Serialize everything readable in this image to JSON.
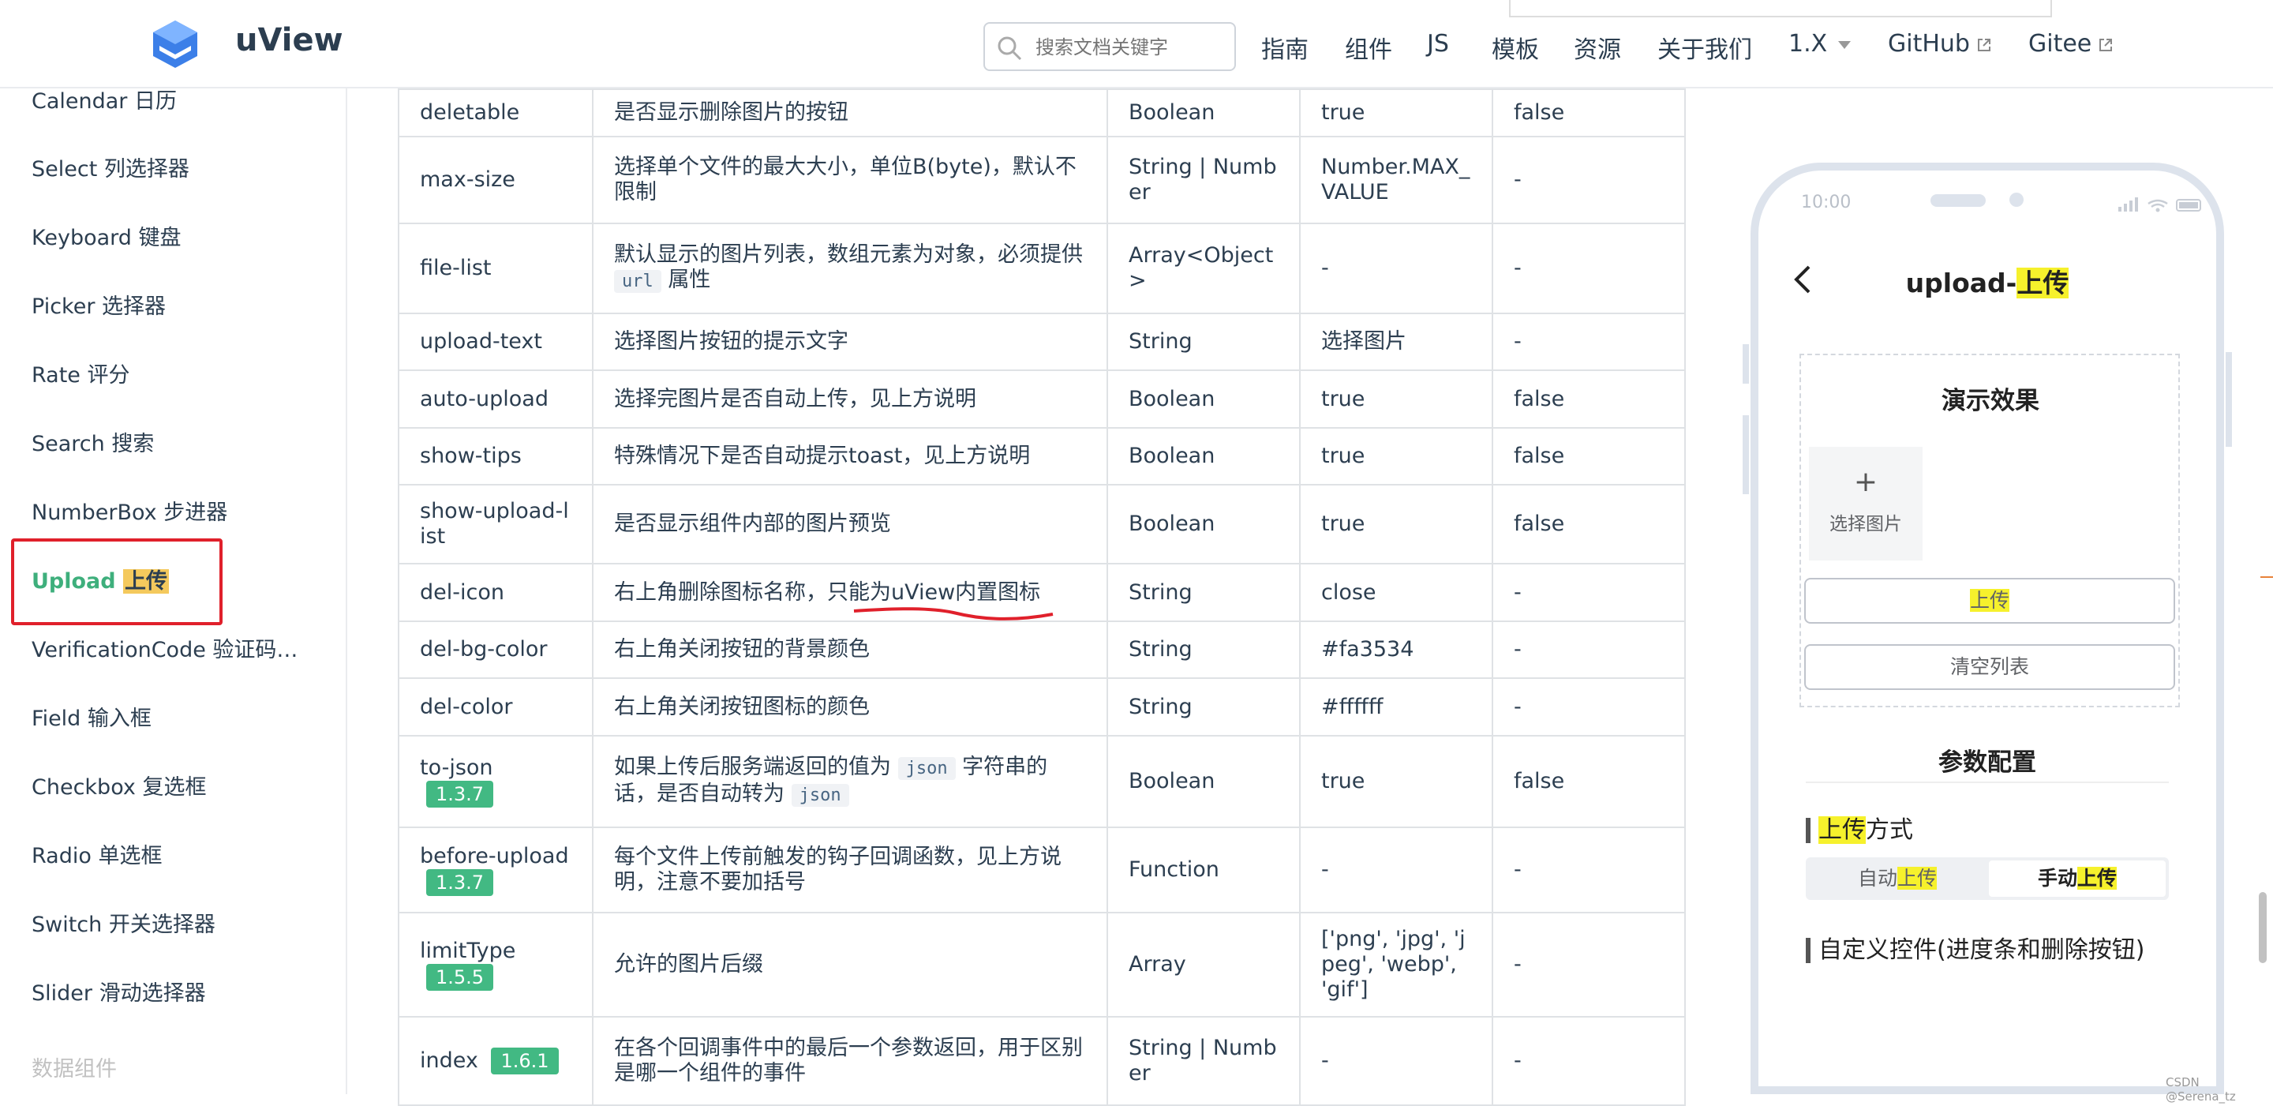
{
  "header": {
    "brand": "uView",
    "search_placeholder": "搜索文档关键字",
    "nav": [
      "指南",
      "组件",
      "JS",
      "模板",
      "资源",
      "关于我们"
    ],
    "version": "1.X",
    "github": "GitHub",
    "gitee": "Gitee"
  },
  "sidebar": {
    "items": [
      "Calendar 日历",
      "Select 列选择器",
      "Keyboard 键盘",
      "Picker 选择器",
      "Rate 评分",
      "Search 搜索",
      "NumberBox 步进器",
      "Upload",
      "VerificationCode 验证码倒计时",
      "Field 输入框",
      "Checkbox 复选框",
      "Radio 单选框",
      "Switch 开关选择器",
      "Slider 滑动选择器"
    ],
    "active_highlight": "上传",
    "partial": "数据组件"
  },
  "table": {
    "rows": [
      {
        "param": "deletable",
        "desc": "是否显示删除图片的按钮",
        "type": "Boolean",
        "default": "true",
        "options": "false"
      },
      {
        "param": "max-size",
        "desc": "选择单个文件的最大大小，单位B(byte)，默认不限制",
        "type": "String | Number",
        "default": "Number.MAX_VALUE",
        "options": "-"
      },
      {
        "param": "file-list",
        "desc_a": "默认显示的图片列表，数组元素为对象，必须提供",
        "desc_code": "url",
        "desc_b": "属性",
        "type": "Array<Object>",
        "default": "-",
        "options": "-"
      },
      {
        "param": "upload-text",
        "desc": "选择图片按钮的提示文字",
        "type": "String",
        "default": "选择图片",
        "options": "-"
      },
      {
        "param": "auto-upload",
        "desc": "选择完图片是否自动上传，见上方说明",
        "type": "Boolean",
        "default": "true",
        "options": "false"
      },
      {
        "param": "show-tips",
        "desc": "特殊情况下是否自动提示toast，见上方说明",
        "type": "Boolean",
        "default": "true",
        "options": "false"
      },
      {
        "param": "show-upload-list",
        "desc": "是否显示组件内部的图片预览",
        "type": "Boolean",
        "default": "true",
        "options": "false"
      },
      {
        "param": "del-icon",
        "desc": "右上角删除图标名称，只能为uView内置图标",
        "type": "String",
        "default": "close",
        "options": "-"
      },
      {
        "param": "del-bg-color",
        "desc": "右上角关闭按钮的背景颜色",
        "type": "String",
        "default": "#fa3534",
        "options": "-"
      },
      {
        "param": "del-color",
        "desc": "右上角关闭按钮图标的颜色",
        "type": "String",
        "default": "#ffffff",
        "options": "-"
      },
      {
        "param": "to-json",
        "badge": "1.3.7",
        "desc_a": "如果上传后服务端返回的值为",
        "desc_code": "json",
        "desc_b": "字符串的话，是否自动转为",
        "desc_code2": "json",
        "type": "Boolean",
        "default": "true",
        "options": "false"
      },
      {
        "param": "before-upload",
        "badge": "1.3.7",
        "desc": "每个文件上传前触发的钩子回调函数，见上方说明，注意不要加括号",
        "type": "Function",
        "default": "-",
        "options": "-"
      },
      {
        "param": "limitType",
        "badge": "1.5.5",
        "desc": "允许的图片后缀",
        "type": "Array",
        "default": "['png', 'jpg', 'jpeg', 'webp', 'gif']",
        "options": "-"
      },
      {
        "param": "index",
        "badge": "1.6.1",
        "desc": "在各个回调事件中的最后一个参数返回，用于区别是哪一个组件的事件",
        "type": "String | Number",
        "default": "-",
        "options": "-"
      }
    ]
  },
  "phone": {
    "time": "10:00",
    "title_a": "upload-",
    "title_hl": "上传",
    "demo_title": "演示效果",
    "pick_plus": "+",
    "pick_label": "选择图片",
    "upload_btn": "上传",
    "clear_btn": "清空列表",
    "config_title": "参数配置",
    "mode_label_hl": "上传",
    "mode_label_rest": "方式",
    "seg_auto": "自动",
    "seg_manual": "手动",
    "seg_hl": "上传",
    "custom_label": "自定义控件(进度条和删除按钮)"
  },
  "watermark": "CSDN @Serena_tz",
  "colors": {
    "accent": "#3eaf7c",
    "badge": "#42b983",
    "highlight_yellow": "#f6f12c",
    "annotation_red": "#e0202b"
  }
}
